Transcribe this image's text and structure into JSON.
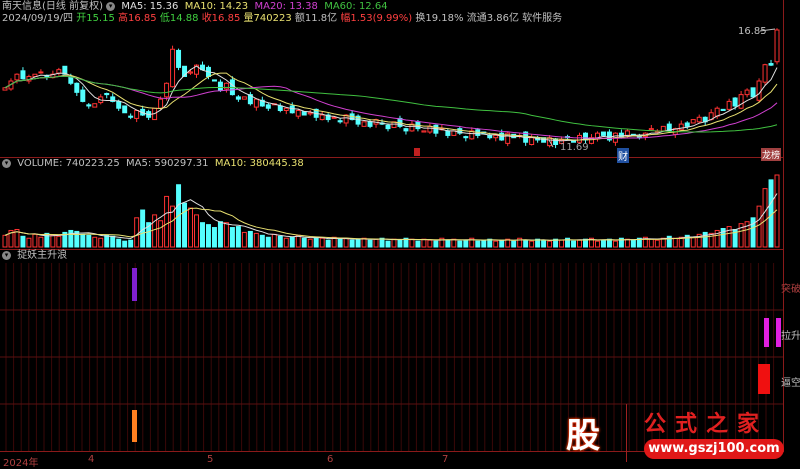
{
  "header": {
    "stock_name": "南天信息(日线 前复权)",
    "ma5": "MA5: 15.36",
    "ma10": "MA10: 14.23",
    "ma20": "MA20: 13.38",
    "ma60": "MA60: 12.64",
    "date": "2024/09/19/四",
    "open": "开15.15",
    "high": "高16.85",
    "low": "低14.88",
    "close": "收16.85",
    "volume": "量740223",
    "amount": "额11.8亿",
    "change": "幅1.53(9.99%)",
    "turnover": "换19.18%",
    "float": "流通3.86亿",
    "sector": "软件服务"
  },
  "price_labels": {
    "high": "16.85",
    "low": "11.69"
  },
  "markers": {
    "finance": "财",
    "event": "龙榜"
  },
  "volume_panel": {
    "volume": "VOLUME: 740223.25",
    "ma5": "MA5: 590297.31",
    "ma10": "MA10: 380445.38"
  },
  "indicator_panel": {
    "title": "捉妖主升浪",
    "labels": [
      "突破",
      "拉升",
      "逼空"
    ]
  },
  "x_axis": [
    "2024年",
    "4",
    "5",
    "6",
    "7"
  ],
  "watermark": {
    "logo": "股",
    "name": "公式之家",
    "url": "www.gszj100.com"
  },
  "colors": {
    "up": "#ff3232",
    "down": "#54ffff",
    "ma5": "#e0e0e0",
    "ma10": "#e8e070",
    "ma20": "#d040d0",
    "ma60": "#40c040"
  },
  "series": {
    "close": [
      14.3,
      14.6,
      14.9,
      14.7,
      14.8,
      14.9,
      15.0,
      14.8,
      14.9,
      15.1,
      14.9,
      14.5,
      14.1,
      13.7,
      13.5,
      13.6,
      13.9,
      14.0,
      13.7,
      13.4,
      13.2,
      13.0,
      13.3,
      13.1,
      13.0,
      13.4,
      13.8,
      14.5,
      16.0,
      15.2,
      14.8,
      15.0,
      15.3,
      15.1,
      14.8,
      14.6,
      14.2,
      14.5,
      14.0,
      13.8,
      13.9,
      13.6,
      13.8,
      13.5,
      13.4,
      13.6,
      13.3,
      13.4,
      13.2,
      13.3,
      13.1,
      13.2,
      13.0,
      13.1,
      12.9,
      13.0,
      12.8,
      13.1,
      12.9,
      12.7,
      12.8,
      12.6,
      12.9,
      12.7,
      12.5,
      12.8,
      12.6,
      12.4,
      12.7,
      12.5,
      12.4,
      12.6,
      12.3,
      12.5,
      12.2,
      12.4,
      12.3,
      12.1,
      12.4,
      12.2,
      12.3,
      12.1,
      12.2,
      12.0,
      12.3,
      12.1,
      12.2,
      11.9,
      12.1,
      12.0,
      11.9,
      12.1,
      11.8,
      12.0,
      12.1,
      11.9,
      12.2,
      12.0,
      12.1,
      12.3,
      12.2,
      12.0,
      12.3,
      12.1,
      12.4,
      12.2,
      12.1,
      12.3,
      12.5,
      12.4,
      12.6,
      12.4,
      12.5,
      12.7,
      12.6,
      12.9,
      13.0,
      12.8,
      13.2,
      13.4,
      13.3,
      13.7,
      13.5,
      14.0,
      14.2,
      13.9,
      14.6,
      15.32,
      15.3,
      16.85
    ],
    "volume": [
      120,
      170,
      180,
      110,
      90,
      130,
      100,
      140,
      120,
      110,
      150,
      170,
      160,
      130,
      120,
      100,
      90,
      120,
      110,
      80,
      60,
      70,
      300,
      380,
      250,
      330,
      270,
      520,
      420,
      640,
      450,
      400,
      330,
      250,
      230,
      200,
      260,
      250,
      200,
      210,
      150,
      160,
      140,
      120,
      100,
      130,
      110,
      90,
      100,
      120,
      90,
      80,
      100,
      90,
      70,
      100,
      80,
      90,
      70,
      80,
      90,
      70,
      80,
      90,
      60,
      80,
      70,
      90,
      80,
      60,
      80,
      70,
      60,
      90,
      70,
      80,
      60,
      70,
      90,
      60,
      70,
      80,
      60,
      70,
      80,
      60,
      90,
      70,
      60,
      80,
      70,
      60,
      80,
      70,
      90,
      60,
      70,
      80,
      90,
      60,
      70,
      80,
      60,
      90,
      80,
      70,
      90,
      100,
      80,
      70,
      90,
      110,
      90,
      100,
      120,
      100,
      130,
      150,
      140,
      170,
      190,
      210,
      180,
      240,
      260,
      300,
      420,
      600,
      690,
      740
    ]
  }
}
